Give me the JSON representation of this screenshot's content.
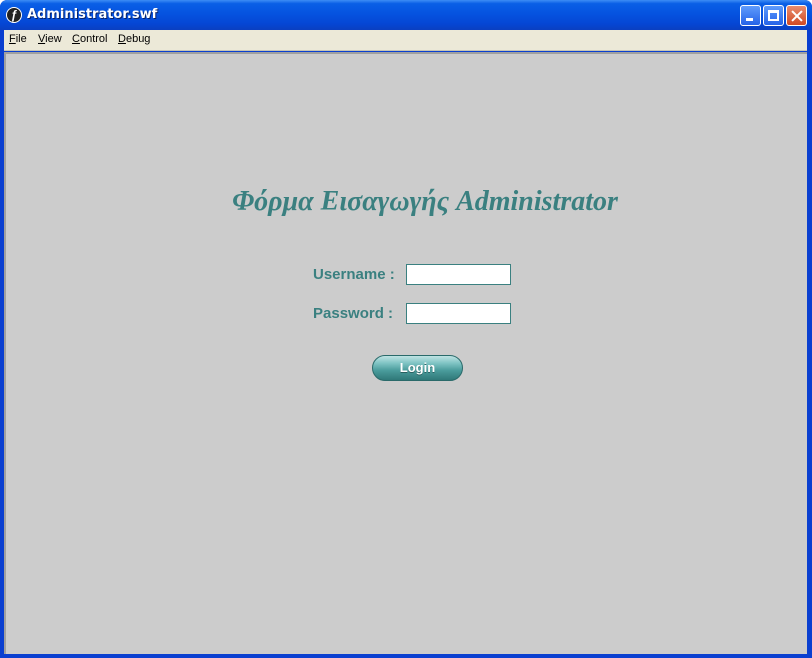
{
  "window": {
    "title": "Administrator.swf",
    "controls": {
      "minimize": "minimize",
      "maximize": "maximize",
      "close": "close"
    }
  },
  "menu": {
    "items": [
      {
        "label": "File",
        "accel": "F",
        "rest": "ile"
      },
      {
        "label": "View",
        "accel": "V",
        "rest": "iew"
      },
      {
        "label": "Control",
        "accel": "C",
        "rest": "ontrol"
      },
      {
        "label": "Debug",
        "accel": "D",
        "rest": "ebug"
      }
    ]
  },
  "form": {
    "title": "Φόρμα Εισαγωγής Administrator",
    "username_label": "Username :",
    "username_value": "",
    "password_label": "Password :",
    "password_value": "",
    "login_label": "Login"
  },
  "colors": {
    "accent": "#3a8080",
    "stage_bg": "#cccccc",
    "titlebar": "#0553e0"
  }
}
